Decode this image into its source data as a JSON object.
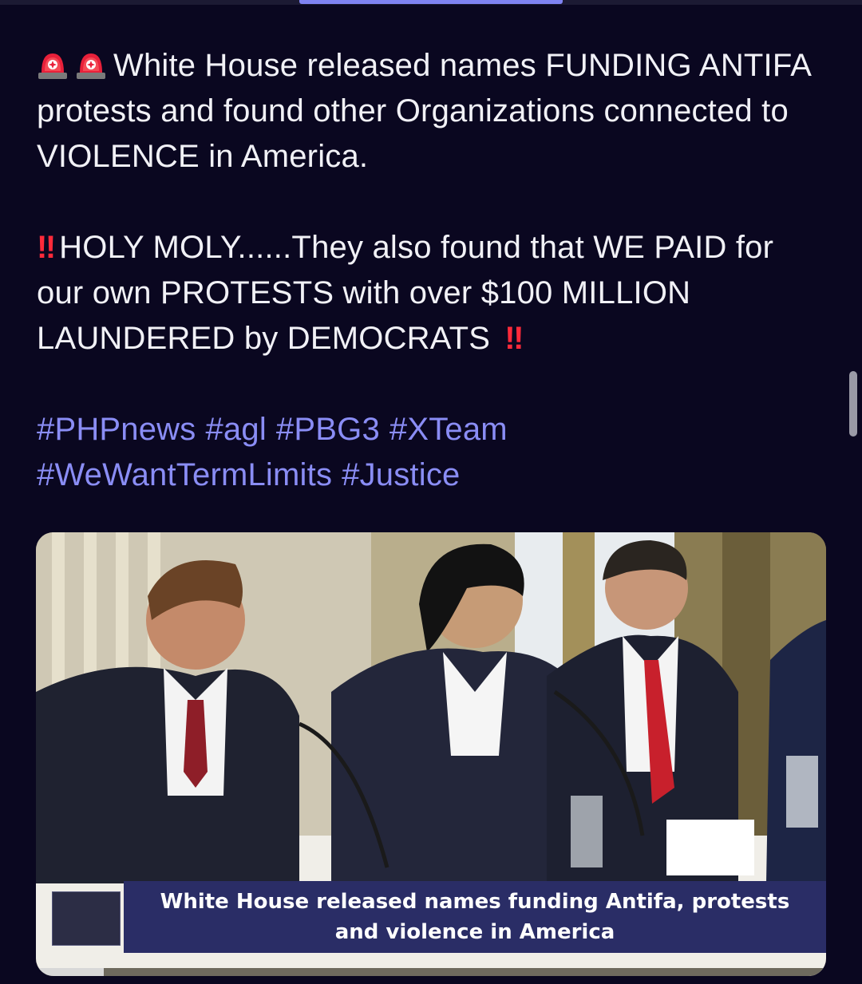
{
  "post": {
    "line1_text": "White House released names FUNDING ANTIFA protests and found other Organizations connected to VIOLENCE in America.",
    "line2_bang": "‼",
    "line2_text": "HOLY MOLY......They also found that WE PAID for our own PROTESTS with over $100 MILLION LAUNDERED by DEMOCRATS",
    "line2_bang_trail": "‼",
    "hashtags": [
      "#PHPnews",
      "#agl",
      "#PBG3",
      "#XTeam",
      "#WeWantTermLimits",
      "#Justice"
    ]
  },
  "icons": {
    "emoji_1": "police-car-light-icon",
    "emoji_2": "double-exclamation-icon"
  },
  "video": {
    "caption": "White House released names funding Antifa, protests and violence in America",
    "progress": 0.086
  },
  "colors": {
    "background": "#0a0720",
    "text": "#f1f1f6",
    "hashtag": "#8a8df5",
    "accent_tab": "#7f83f2",
    "caption_bar": "#2a2d66",
    "alert_red": "#ff2a3a"
  }
}
